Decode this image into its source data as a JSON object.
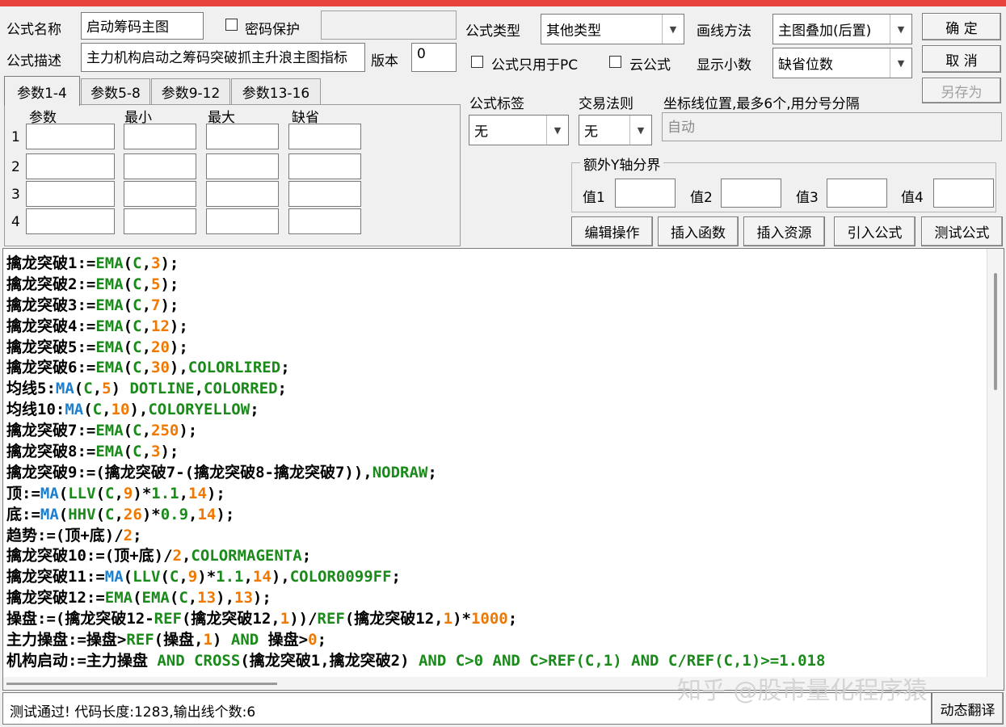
{
  "header": {
    "name_label": "公式名称",
    "name_value": "启动筹码主图",
    "password_label": "密码保护",
    "desc_label": "公式描述",
    "desc_value": "主力机构启动之筹码突破抓主升浪主图指标",
    "version_label": "版本",
    "version_value": "0",
    "type_label": "公式类型",
    "type_value": "其他类型",
    "draw_label": "画线方法",
    "draw_value": "主图叠加(后置)",
    "pc_only_label": "公式只用于PC",
    "cloud_label": "云公式",
    "decimals_label": "显示小数",
    "decimals_value": "缺省位数"
  },
  "buttons": {
    "ok": "确 定",
    "cancel": "取 消",
    "save_as": "另存为",
    "edit_ops": "编辑操作",
    "insert_func": "插入函数",
    "insert_res": "插入资源",
    "import_formula": "引入公式",
    "test_formula": "测试公式",
    "dyn_translate": "动态翻译"
  },
  "tabs": [
    "参数1-4",
    "参数5-8",
    "参数9-12",
    "参数13-16"
  ],
  "params": {
    "headers": [
      "参数",
      "最小",
      "最大",
      "缺省"
    ],
    "rows": [
      "1",
      "2",
      "3",
      "4"
    ]
  },
  "right": {
    "tag_label": "公式标签",
    "tag_value": "无",
    "rule_label": "交易法则",
    "rule_value": "无",
    "coord_label": "坐标线位置,最多6个,用分号分隔",
    "coord_value": "自动",
    "yaxis_group": "额外Y轴分界",
    "val1": "值1",
    "val2": "值2",
    "val3": "值3",
    "val4": "值4"
  },
  "code_lines": [
    [
      [
        "擒龙突破1:=",
        ""
      ],
      [
        "EMA",
        "g"
      ],
      [
        "(",
        ""
      ],
      [
        "C",
        "g"
      ],
      [
        ",",
        ""
      ],
      [
        "3",
        "o"
      ],
      [
        ");",
        ""
      ]
    ],
    [
      [
        "擒龙突破2:=",
        ""
      ],
      [
        "EMA",
        "g"
      ],
      [
        "(",
        ""
      ],
      [
        "C",
        "g"
      ],
      [
        ",",
        ""
      ],
      [
        "5",
        "o"
      ],
      [
        ");",
        ""
      ]
    ],
    [
      [
        "擒龙突破3:=",
        ""
      ],
      [
        "EMA",
        "g"
      ],
      [
        "(",
        ""
      ],
      [
        "C",
        "g"
      ],
      [
        ",",
        ""
      ],
      [
        "7",
        "o"
      ],
      [
        ");",
        ""
      ]
    ],
    [
      [
        "擒龙突破4:=",
        ""
      ],
      [
        "EMA",
        "g"
      ],
      [
        "(",
        ""
      ],
      [
        "C",
        "g"
      ],
      [
        ",",
        ""
      ],
      [
        "12",
        "o"
      ],
      [
        ");",
        ""
      ]
    ],
    [
      [
        "擒龙突破5:=",
        ""
      ],
      [
        "EMA",
        "g"
      ],
      [
        "(",
        ""
      ],
      [
        "C",
        "g"
      ],
      [
        ",",
        ""
      ],
      [
        "20",
        "o"
      ],
      [
        ");",
        ""
      ]
    ],
    [
      [
        "擒龙突破6:=",
        ""
      ],
      [
        "EMA",
        "g"
      ],
      [
        "(",
        ""
      ],
      [
        "C",
        "g"
      ],
      [
        ",",
        ""
      ],
      [
        "30",
        "o"
      ],
      [
        "),",
        ""
      ],
      [
        "COLORLIRED",
        "g"
      ],
      [
        ";",
        ""
      ]
    ],
    [
      [
        "均线5:",
        ""
      ],
      [
        "MA",
        "b"
      ],
      [
        "(",
        ""
      ],
      [
        "C",
        "g"
      ],
      [
        ",",
        ""
      ],
      [
        "5",
        "o"
      ],
      [
        ") ",
        ""
      ],
      [
        "DOTLINE",
        "g"
      ],
      [
        ",",
        ""
      ],
      [
        "COLORRED",
        "g"
      ],
      [
        ";",
        ""
      ]
    ],
    [
      [
        "均线10:",
        ""
      ],
      [
        "MA",
        "b"
      ],
      [
        "(",
        ""
      ],
      [
        "C",
        "g"
      ],
      [
        ",",
        ""
      ],
      [
        "10",
        "o"
      ],
      [
        "),",
        ""
      ],
      [
        "COLORYELLOW",
        "g"
      ],
      [
        ";",
        ""
      ]
    ],
    [
      [
        "擒龙突破7:=",
        ""
      ],
      [
        "EMA",
        "g"
      ],
      [
        "(",
        ""
      ],
      [
        "C",
        "g"
      ],
      [
        ",",
        ""
      ],
      [
        "250",
        "o"
      ],
      [
        ");",
        ""
      ]
    ],
    [
      [
        "擒龙突破8:=",
        ""
      ],
      [
        "EMA",
        "g"
      ],
      [
        "(",
        ""
      ],
      [
        "C",
        "g"
      ],
      [
        ",",
        ""
      ],
      [
        "3",
        "o"
      ],
      [
        ");",
        ""
      ]
    ],
    [
      [
        "擒龙突破9:=(擒龙突破7-(擒龙突破8-擒龙突破7)),",
        ""
      ],
      [
        "NODRAW",
        "g"
      ],
      [
        ";",
        ""
      ]
    ],
    [
      [
        "顶:=",
        ""
      ],
      [
        "MA",
        "b"
      ],
      [
        "(",
        ""
      ],
      [
        "LLV",
        "g"
      ],
      [
        "(",
        ""
      ],
      [
        "C",
        "g"
      ],
      [
        ",",
        ""
      ],
      [
        "9",
        "o"
      ],
      [
        ")*",
        ""
      ],
      [
        "1.1",
        "g"
      ],
      [
        ",",
        ""
      ],
      [
        "14",
        "o"
      ],
      [
        ");",
        ""
      ]
    ],
    [
      [
        "底:=",
        ""
      ],
      [
        "MA",
        "b"
      ],
      [
        "(",
        ""
      ],
      [
        "HHV",
        "g"
      ],
      [
        "(",
        ""
      ],
      [
        "C",
        "g"
      ],
      [
        ",",
        ""
      ],
      [
        "26",
        "o"
      ],
      [
        ")*",
        ""
      ],
      [
        "0.9",
        "g"
      ],
      [
        ",",
        ""
      ],
      [
        "14",
        "o"
      ],
      [
        ");",
        ""
      ]
    ],
    [
      [
        "趋势:=(顶+底)/",
        ""
      ],
      [
        "2",
        "o"
      ],
      [
        ";",
        ""
      ]
    ],
    [
      [
        "擒龙突破10:=(顶+底)/",
        ""
      ],
      [
        "2",
        "o"
      ],
      [
        ",",
        ""
      ],
      [
        "COLORMAGENTA",
        "g"
      ],
      [
        ";",
        ""
      ]
    ],
    [
      [
        "擒龙突破11:=",
        ""
      ],
      [
        "MA",
        "b"
      ],
      [
        "(",
        ""
      ],
      [
        "LLV",
        "g"
      ],
      [
        "(",
        ""
      ],
      [
        "C",
        "g"
      ],
      [
        ",",
        ""
      ],
      [
        "9",
        "o"
      ],
      [
        ")*",
        ""
      ],
      [
        "1.1",
        "g"
      ],
      [
        ",",
        ""
      ],
      [
        "14",
        "o"
      ],
      [
        "),",
        ""
      ],
      [
        "COLOR0099FF",
        "g"
      ],
      [
        ";",
        ""
      ]
    ],
    [
      [
        "擒龙突破12:=",
        ""
      ],
      [
        "EMA",
        "g"
      ],
      [
        "(",
        ""
      ],
      [
        "EMA",
        "g"
      ],
      [
        "(",
        ""
      ],
      [
        "C",
        "g"
      ],
      [
        ",",
        ""
      ],
      [
        "13",
        "o"
      ],
      [
        "),",
        ""
      ],
      [
        "13",
        "o"
      ],
      [
        ");",
        ""
      ]
    ],
    [
      [
        "操盘:=(擒龙突破12-",
        ""
      ],
      [
        "REF",
        "g"
      ],
      [
        "(擒龙突破12,",
        ""
      ],
      [
        "1",
        "o"
      ],
      [
        "))/",
        ""
      ],
      [
        "REF",
        "g"
      ],
      [
        "(擒龙突破12,",
        ""
      ],
      [
        "1",
        "o"
      ],
      [
        ")*",
        ""
      ],
      [
        "1000",
        "o"
      ],
      [
        ";",
        ""
      ]
    ],
    [
      [
        "主力操盘:=操盘>",
        ""
      ],
      [
        "REF",
        "g"
      ],
      [
        "(操盘,",
        ""
      ],
      [
        "1",
        "o"
      ],
      [
        ") ",
        ""
      ],
      [
        "AND",
        "g"
      ],
      [
        " 操盘>",
        ""
      ],
      [
        "0",
        "o"
      ],
      [
        ";",
        ""
      ]
    ],
    [
      [
        "机构启动:=主力操盘 ",
        ""
      ],
      [
        "AND",
        "g"
      ],
      [
        " ",
        ""
      ],
      [
        "CROSS",
        "g"
      ],
      [
        "(擒龙突破1,擒龙突破2) ",
        ""
      ],
      [
        "AND",
        "g"
      ],
      [
        " ",
        ""
      ],
      [
        "C>0",
        "g"
      ],
      [
        " ",
        ""
      ],
      [
        "AND",
        "g"
      ],
      [
        " ",
        ""
      ],
      [
        "C>REF(C,1)",
        "g"
      ],
      [
        " ",
        ""
      ],
      [
        "AND",
        "g"
      ],
      [
        " ",
        ""
      ],
      [
        "C/REF(C,1)>=1.018",
        "g"
      ]
    ]
  ],
  "status": "测试通过! 代码长度:1283,输出线个数:6",
  "watermark": "知乎 @股市量化程序猿"
}
